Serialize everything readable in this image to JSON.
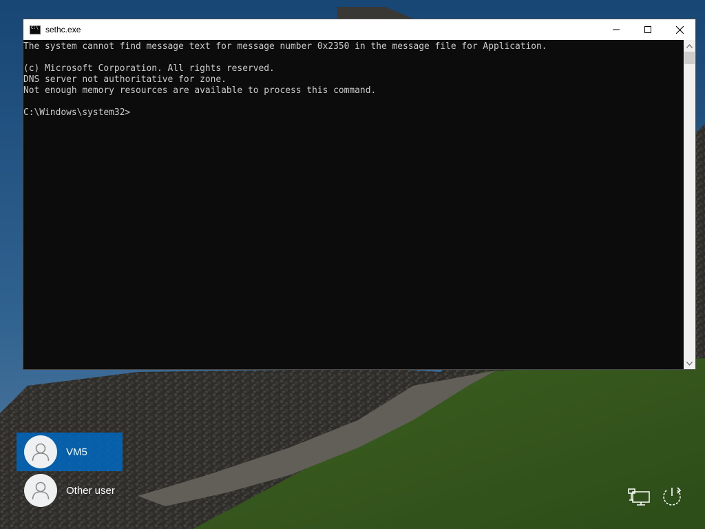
{
  "window": {
    "title": "sethc.exe",
    "icon": "console-icon",
    "minimize_icon": "minimize-icon",
    "maximize_icon": "maximize-icon",
    "close_icon": "close-icon"
  },
  "console": {
    "lines": [
      "The system cannot find message text for message number 0x2350 in the message file for Application.",
      "",
      "(c) Microsoft Corporation. All rights reserved.",
      "DNS server not authoritative for zone.",
      "Not enough memory resources are available to process this command.",
      "",
      "C:\\Windows\\system32>"
    ],
    "text_color": "#cccccc",
    "background": "#0c0c0c"
  },
  "users": [
    {
      "name": "VM5",
      "selected": true
    },
    {
      "name": "Other user",
      "selected": false
    }
  ],
  "corner_icons": {
    "network": "network-icon",
    "power": "power-icon"
  },
  "colors": {
    "selection_accent": "#0067c0"
  }
}
